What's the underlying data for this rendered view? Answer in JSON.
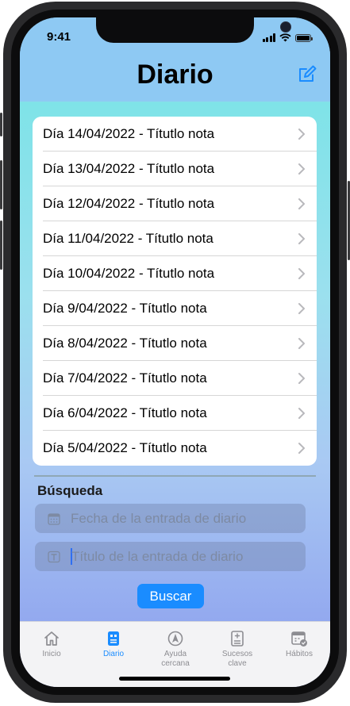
{
  "status_bar": {
    "time": "9:41"
  },
  "header": {
    "title": "Diario"
  },
  "entries": [
    {
      "label": "Día 14/04/2022 - Títutlo nota"
    },
    {
      "label": "Día 13/04/2022 - Títutlo nota"
    },
    {
      "label": "Día 12/04/2022 - Títutlo nota"
    },
    {
      "label": "Día 11/04/2022 - Títutlo nota"
    },
    {
      "label": "Día 10/04/2022 - Títutlo nota"
    },
    {
      "label": "Día 9/04/2022 - Títutlo nota"
    },
    {
      "label": "Día 8/04/2022 - Títutlo nota"
    },
    {
      "label": "Día 7/04/2022 - Títutlo nota"
    },
    {
      "label": "Día 6/04/2022 - Títutlo nota"
    },
    {
      "label": "Día 5/04/2022 - Títutlo nota"
    }
  ],
  "search": {
    "title": "Búsqueda",
    "date_placeholder": "Fecha de la entrada de diario",
    "title_placeholder": "Título de la entrada de diario",
    "button_label": "Buscar"
  },
  "tabs": [
    {
      "label": "Inicio",
      "icon": "house-icon",
      "active": false
    },
    {
      "label": "Diario",
      "icon": "journal-icon",
      "active": true
    },
    {
      "label": "Ayuda cercana",
      "icon": "location-arrow-icon",
      "active": false
    },
    {
      "label": "Sucesos clave",
      "icon": "key-events-icon",
      "active": false
    },
    {
      "label": "Hábitos",
      "icon": "habits-calendar-icon",
      "active": false
    }
  ],
  "colors": {
    "accent": "#1a8cff",
    "header": "#8ec9f3",
    "tab_inactive": "#8d8d92"
  }
}
